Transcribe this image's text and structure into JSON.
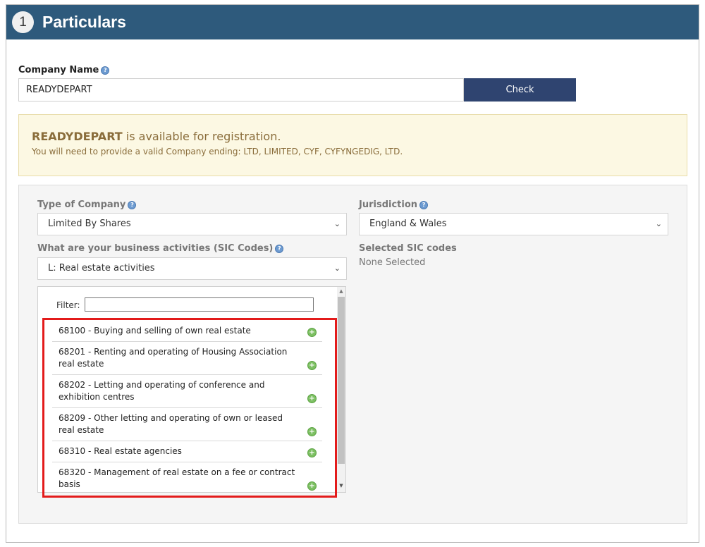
{
  "header": {
    "step": "1",
    "title": "Particulars"
  },
  "company": {
    "label": "Company Name",
    "value": "READYDEPART",
    "check_label": "Check"
  },
  "availability": {
    "name": "READYDEPART",
    "message": " is available for registration.",
    "hint": "You will need to provide a valid Company ending: LTD, LIMITED, CYF, CYFYNGEDIG, LTD."
  },
  "form": {
    "type_label": "Type of Company",
    "type_value": "Limited By Shares",
    "jurisdiction_label": "Jurisdiction",
    "jurisdiction_value": "England & Wales",
    "sic_label": "What are your business activities (SIC Codes)",
    "sic_value": "L: Real estate activities",
    "selected_label": "Selected SIC codes",
    "selected_value": "None Selected",
    "filter_label": "Filter:"
  },
  "sic_items": [
    "68100 - Buying and selling of own real estate",
    "68201 - Renting and operating of Housing Association real estate",
    "68202 - Letting and operating of conference and exhibition centres",
    "68209 - Other letting and operating of own or leased real estate",
    "68310 - Real estate agencies",
    "68320 - Management of real estate on a fee or contract basis"
  ],
  "icons": {
    "help": "help-icon",
    "add": "add-icon",
    "dropdown": "chevron-down-icon"
  },
  "colors": {
    "header_bg": "#2e5a7c",
    "check_button": "#2f4470",
    "alert_bg": "#fcf8e3",
    "alert_text": "#8a6d3b",
    "add_icon": "#7cbf62",
    "highlight": "#e31b1b"
  }
}
